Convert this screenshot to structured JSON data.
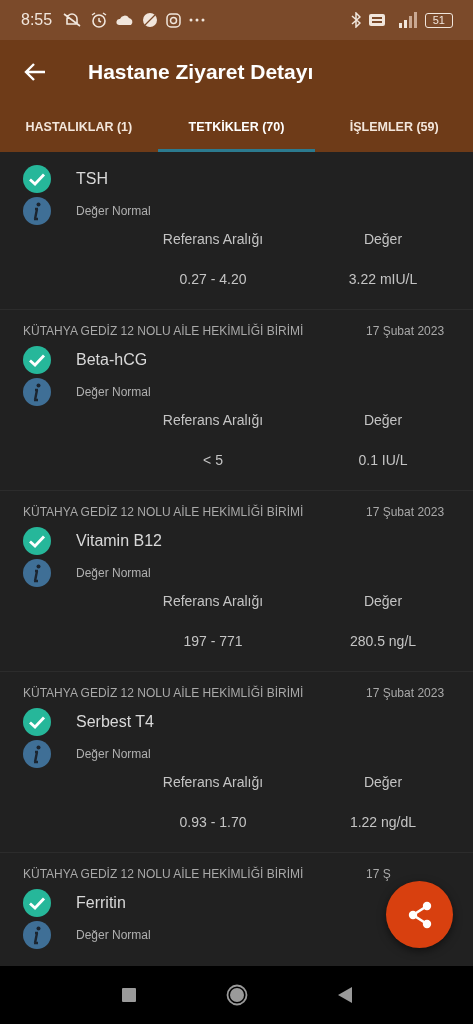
{
  "status_bar": {
    "time": "8:55",
    "battery": "51"
  },
  "app_bar": {
    "title": "Hastane Ziyaret Detayı"
  },
  "tabs": [
    {
      "label": "HASTALIKLAR (1)",
      "selected": false
    },
    {
      "label": "TETKİKLER (70)",
      "selected": true
    },
    {
      "label": "İŞLEMLER (59)",
      "selected": false
    }
  ],
  "tests": [
    {
      "name": "TSH",
      "status": "Değer Normal",
      "range_label": "Referans Aralığı",
      "value_label": "Değer",
      "range": "0.27 - 4.20",
      "value": "3.22 mIU/L"
    },
    {
      "institution": "KÜTAHYA GEDİZ 12 NOLU AİLE HEKİMLİĞİ BİRİMİ",
      "date": "17 Şubat 2023",
      "name": "Beta-hCG",
      "status": "Değer Normal",
      "range_label": "Referans Aralığı",
      "value_label": "Değer",
      "range": "< 5",
      "value": "0.1 IU/L"
    },
    {
      "institution": "KÜTAHYA GEDİZ 12 NOLU AİLE HEKİMLİĞİ BİRİMİ",
      "date": "17 Şubat 2023",
      "name": "Vitamin B12",
      "status": "Değer Normal",
      "range_label": "Referans Aralığı",
      "value_label": "Değer",
      "range": "197 - 771",
      "value": "280.5 ng/L"
    },
    {
      "institution": "KÜTAHYA GEDİZ 12 NOLU AİLE HEKİMLİĞİ BİRİMİ",
      "date": "17 Şubat 2023",
      "name": "Serbest T4",
      "status": "Değer Normal",
      "range_label": "Referans Aralığı",
      "value_label": "Değer",
      "range": "0.93 - 1.70",
      "value": "1.22 ng/dL"
    },
    {
      "institution": "KÜTAHYA GEDİZ 12 NOLU AİLE HEKİMLİĞİ BİRİMİ",
      "date": "17 Ş",
      "name": "Ferritin",
      "status": "Değer Normal"
    }
  ]
}
